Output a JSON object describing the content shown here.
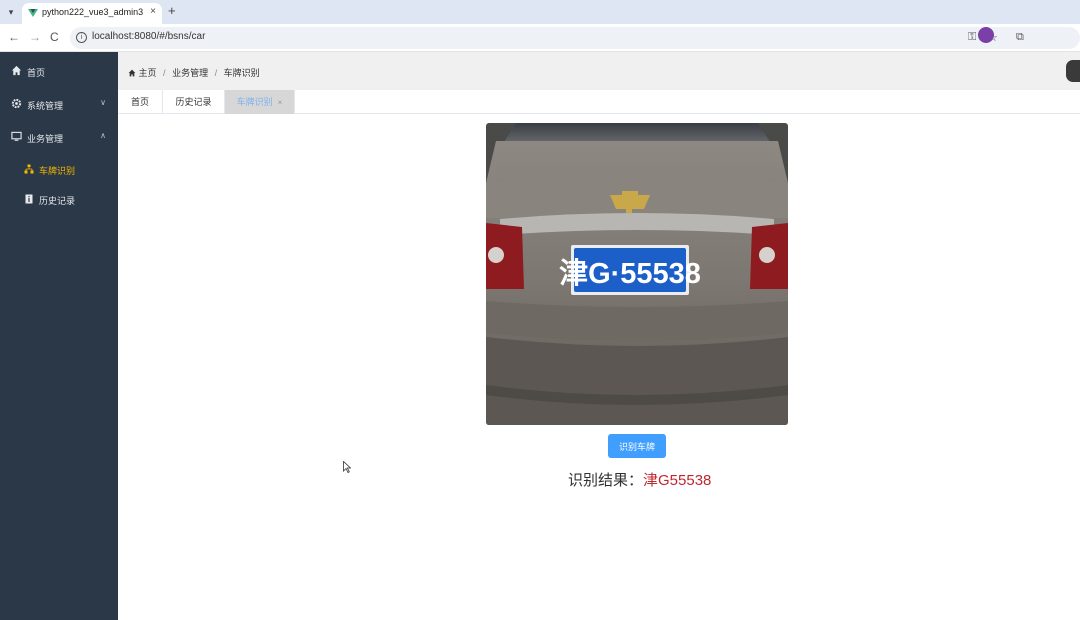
{
  "browser": {
    "tab_title": "python222_vue3_admin3",
    "tab_close": "×",
    "new_tab": "+",
    "url": "localhost:8080/#/bsns/car",
    "back": "←",
    "forward": "→",
    "reload": "C"
  },
  "sidebar": {
    "items": [
      {
        "label": "首页",
        "icon": "home-icon"
      },
      {
        "label": "系统管理",
        "icon": "gear-icon",
        "arrow": "∨"
      },
      {
        "label": "业务管理",
        "icon": "monitor-icon",
        "arrow": "∧"
      }
    ],
    "sub_items": [
      {
        "label": "车牌识别",
        "icon": "org-chart-icon",
        "active": true
      },
      {
        "label": "历史记录",
        "icon": "info-icon"
      }
    ]
  },
  "header": {
    "breadcrumb": [
      "主页",
      "业务管理",
      "车牌识别"
    ],
    "sep": "/"
  },
  "page_tabs": {
    "items": [
      {
        "label": "首页"
      },
      {
        "label": "历史记录"
      },
      {
        "label": "车牌识别",
        "active": true,
        "close": "×"
      }
    ]
  },
  "main": {
    "plate_text": "津G·55538",
    "button_label": "识别车牌",
    "result_label": "识别结果：",
    "result_value": "津G55538"
  },
  "colors": {
    "sidebar_bg": "#2b3847",
    "active_menu": "#f5b800",
    "primary": "#409eff",
    "result_value": "#c0272d"
  }
}
